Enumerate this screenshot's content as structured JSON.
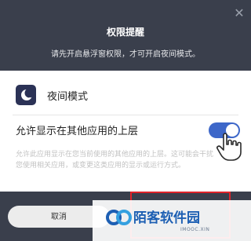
{
  "dialog": {
    "title": "权限提醒",
    "message": "请先开启悬浮窗权限，才可开启夜间模式。",
    "close_icon": "close-icon"
  },
  "app": {
    "icon": "moon-icon",
    "name": "夜间模式"
  },
  "permission": {
    "label": "允许显示在其他应用的上层",
    "toggle_state": true,
    "description": "允许此应用显示在您当前使用的其他应用的上层。这可能会干扰您使用相关应用，或变更这类应用的显示或运行方式。"
  },
  "buttons": {
    "cancel_label": "取消"
  },
  "watermark": {
    "name": "陌客软件园",
    "domain": "IMOOC.XIN"
  },
  "colors": {
    "backdrop": "#3a3f4c",
    "toggle_on": "#3d67c9",
    "highlight": "#e0232a",
    "watermark_blue": "#1d5fb3"
  }
}
